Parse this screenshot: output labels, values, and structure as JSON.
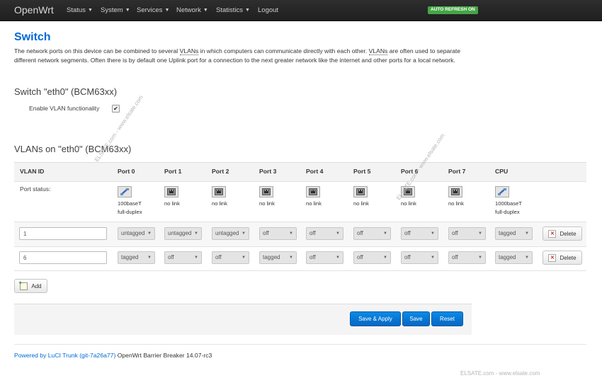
{
  "navbar": {
    "brand": "OpenWrt",
    "menu": [
      "Status",
      "System",
      "Services",
      "Network",
      "Statistics"
    ],
    "logout": "Logout",
    "auto_refresh": "AUTO REFRESH ON"
  },
  "page": {
    "title": "Switch",
    "desc_1": "The network ports on this device can be combined to several ",
    "desc_vlans": "VLANs",
    "desc_2": " in which computers can communicate directly with each other. ",
    "desc_3": " are often used to separate different network segments. Often there is by default one Uplink port for a connection to the next greater network like the internet and other ports for a local network."
  },
  "switch_section": {
    "title": "Switch \"eth0\" (BCM63xx)",
    "enable_vlan_label": "Enable VLAN functionality",
    "enable_vlan_checked": true
  },
  "vlans_section": {
    "title": "VLANs on \"eth0\" (BCM63xx)",
    "headers": [
      "VLAN ID",
      "Port 0",
      "Port 1",
      "Port 2",
      "Port 3",
      "Port 4",
      "Port 5",
      "Port 6",
      "Port 7",
      "CPU"
    ],
    "port_status_label": "Port status:",
    "port_status": [
      {
        "icon": "port-up-icon",
        "line1": "100baseT",
        "line2": "full-duplex"
      },
      {
        "icon": "port-down-icon",
        "line1": "no link",
        "line2": ""
      },
      {
        "icon": "port-down-icon",
        "line1": "no link",
        "line2": ""
      },
      {
        "icon": "port-down-icon",
        "line1": "no link",
        "line2": ""
      },
      {
        "icon": "port-down-icon",
        "line1": "no link",
        "line2": ""
      },
      {
        "icon": "port-down-icon",
        "line1": "no link",
        "line2": ""
      },
      {
        "icon": "port-down-icon",
        "line1": "no link",
        "line2": ""
      },
      {
        "icon": "port-down-icon",
        "line1": "no link",
        "line2": ""
      },
      {
        "icon": "port-up-icon",
        "line1": "1000baseT",
        "line2": "full-duplex"
      }
    ],
    "rows": [
      {
        "vlan_id": "1",
        "ports": [
          "untagged",
          "untagged",
          "untagged",
          "off",
          "off",
          "off",
          "off",
          "off",
          "tagged"
        ],
        "delete_label": "Delete"
      },
      {
        "vlan_id": "6",
        "ports": [
          "tagged",
          "off",
          "off",
          "tagged",
          "off",
          "off",
          "off",
          "off",
          "tagged"
        ],
        "delete_label": "Delete"
      }
    ],
    "add_label": "Add"
  },
  "actions": {
    "save_apply": "Save & Apply",
    "save": "Save",
    "reset": "Reset"
  },
  "footer": {
    "powered_link": "Powered by LuCI Trunk (git-7a26a77)",
    "version": " OpenWrt Barrier Breaker 14.07-rc3"
  },
  "watermarks": [
    "ELSATE.com - www.elsate.com",
    "ELSATE.com - www.elsate.com",
    "ELSATE.com - www.elsate.com"
  ],
  "colors": {
    "accent": "#0069d6",
    "navbar": "#262626",
    "badge": "#46a546",
    "primary_button": "#0567c3"
  }
}
